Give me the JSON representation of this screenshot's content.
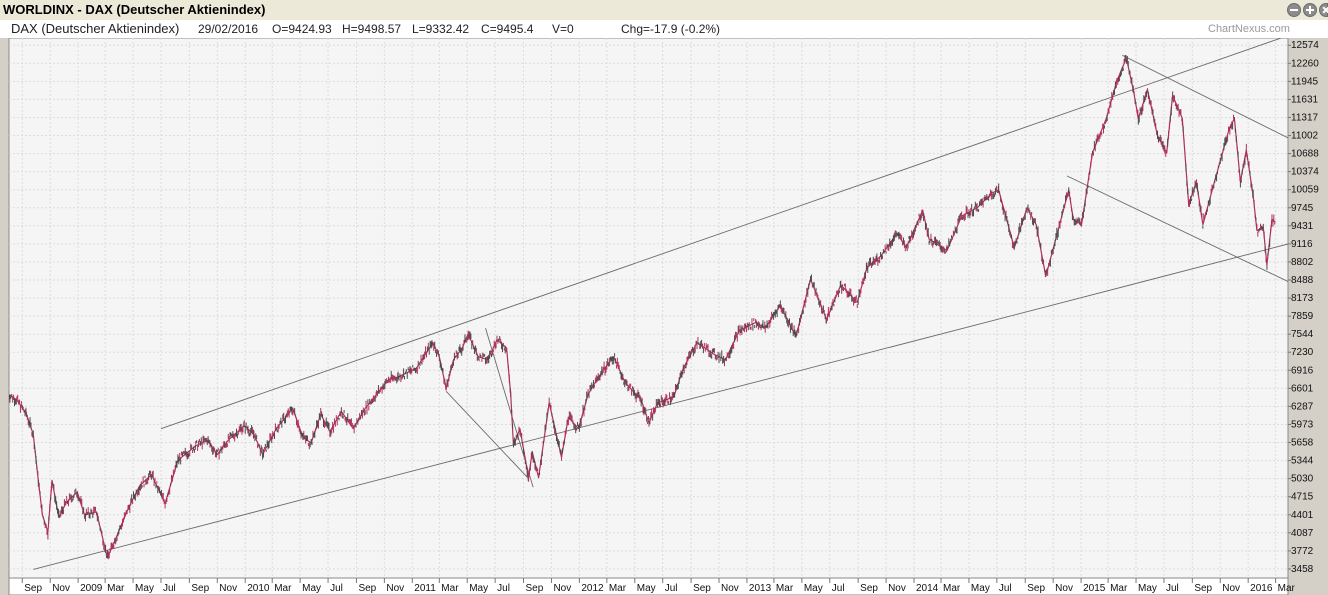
{
  "window": {
    "title": "WORLDINX - DAX (Deutscher Aktienindex)"
  },
  "info": {
    "name": "DAX (Deutscher Aktienindex)",
    "date": "29/02/2016",
    "open": "O=9424.93",
    "high": "H=9498.57",
    "low": "L=9332.42",
    "close": "C=9495.4",
    "volume": "V=0",
    "change": "Chg=-17.9 (-0.2%)",
    "brand": "ChartNexus.com"
  },
  "chart_data": {
    "type": "line",
    "title": "DAX (Deutscher Aktienindex)",
    "xlabel": "",
    "ylabel": "",
    "y_axis_position": "right",
    "grid": true,
    "x_range": [
      "2008-08",
      "2016-03"
    ],
    "ylim": [
      3300,
      12700
    ],
    "y_ticks": [
      3458,
      3772,
      4087,
      4401,
      4715,
      5030,
      5344,
      5658,
      5973,
      6287,
      6601,
      6916,
      7230,
      7544,
      7859,
      8173,
      8488,
      8802,
      9116,
      9431,
      9745,
      10059,
      10374,
      10688,
      11002,
      11317,
      11631,
      11945,
      12260,
      12574
    ],
    "x_ticks": [
      {
        "date": "2008-09",
        "label": "Sep"
      },
      {
        "date": "2008-11",
        "label": "Nov"
      },
      {
        "date": "2009-01",
        "label": "2009"
      },
      {
        "date": "2009-03",
        "label": "Mar"
      },
      {
        "date": "2009-05",
        "label": "May"
      },
      {
        "date": "2009-07",
        "label": "Jul"
      },
      {
        "date": "2009-09",
        "label": "Sep"
      },
      {
        "date": "2009-11",
        "label": "Nov"
      },
      {
        "date": "2010-01",
        "label": "2010"
      },
      {
        "date": "2010-03",
        "label": "Mar"
      },
      {
        "date": "2010-05",
        "label": "May"
      },
      {
        "date": "2010-07",
        "label": "Jul"
      },
      {
        "date": "2010-09",
        "label": "Sep"
      },
      {
        "date": "2010-11",
        "label": "Nov"
      },
      {
        "date": "2011-01",
        "label": "2011"
      },
      {
        "date": "2011-03",
        "label": "Mar"
      },
      {
        "date": "2011-05",
        "label": "May"
      },
      {
        "date": "2011-07",
        "label": "Jul"
      },
      {
        "date": "2011-09",
        "label": "Sep"
      },
      {
        "date": "2011-11",
        "label": "Nov"
      },
      {
        "date": "2012-01",
        "label": "2012"
      },
      {
        "date": "2012-03",
        "label": "Mar"
      },
      {
        "date": "2012-05",
        "label": "May"
      },
      {
        "date": "2012-07",
        "label": "Jul"
      },
      {
        "date": "2012-09",
        "label": "Sep"
      },
      {
        "date": "2012-11",
        "label": "Nov"
      },
      {
        "date": "2013-01",
        "label": "2013"
      },
      {
        "date": "2013-03",
        "label": "Mar"
      },
      {
        "date": "2013-05",
        "label": "May"
      },
      {
        "date": "2013-07",
        "label": "Jul"
      },
      {
        "date": "2013-09",
        "label": "Sep"
      },
      {
        "date": "2013-11",
        "label": "Nov"
      },
      {
        "date": "2014-01",
        "label": "2014"
      },
      {
        "date": "2014-03",
        "label": "Mar"
      },
      {
        "date": "2014-05",
        "label": "May"
      },
      {
        "date": "2014-07",
        "label": "Jul"
      },
      {
        "date": "2014-09",
        "label": "Sep"
      },
      {
        "date": "2014-11",
        "label": "Nov"
      },
      {
        "date": "2015-01",
        "label": "2015"
      },
      {
        "date": "2015-03",
        "label": "Mar"
      },
      {
        "date": "2015-05",
        "label": "May"
      },
      {
        "date": "2015-07",
        "label": "Jul"
      },
      {
        "date": "2015-09",
        "label": "Sep"
      },
      {
        "date": "2015-11",
        "label": "Nov"
      },
      {
        "date": "2016-01",
        "label": "2016"
      },
      {
        "date": "2016-03",
        "label": "Mar"
      }
    ],
    "series": [
      {
        "color": "#b0305a",
        "points": [
          [
            "2008-08-01",
            6500
          ],
          [
            "2008-08-20",
            6400
          ],
          [
            "2008-09-10",
            6150
          ],
          [
            "2008-09-25",
            5800
          ],
          [
            "2008-10-06",
            5000
          ],
          [
            "2008-10-15",
            4400
          ],
          [
            "2008-10-27",
            4100
          ],
          [
            "2008-11-05",
            5000
          ],
          [
            "2008-11-20",
            4350
          ],
          [
            "2008-12-05",
            4600
          ],
          [
            "2008-12-30",
            4800
          ],
          [
            "2009-01-15",
            4400
          ],
          [
            "2009-02-10",
            4450
          ],
          [
            "2009-03-06",
            3650
          ],
          [
            "2009-03-25",
            4000
          ],
          [
            "2009-04-20",
            4500
          ],
          [
            "2009-05-15",
            4900
          ],
          [
            "2009-06-10",
            5100
          ],
          [
            "2009-07-10",
            4600
          ],
          [
            "2009-08-07",
            5350
          ],
          [
            "2009-09-15",
            5600
          ],
          [
            "2009-10-10",
            5700
          ],
          [
            "2009-11-01",
            5450
          ],
          [
            "2009-11-25",
            5700
          ],
          [
            "2009-12-30",
            5950
          ],
          [
            "2010-01-20",
            5800
          ],
          [
            "2010-02-08",
            5450
          ],
          [
            "2010-03-10",
            5900
          ],
          [
            "2010-04-15",
            6250
          ],
          [
            "2010-05-07",
            5750
          ],
          [
            "2010-05-25",
            5650
          ],
          [
            "2010-06-15",
            6150
          ],
          [
            "2010-07-05",
            5850
          ],
          [
            "2010-07-30",
            6200
          ],
          [
            "2010-08-25",
            5900
          ],
          [
            "2010-09-20",
            6250
          ],
          [
            "2010-10-15",
            6500
          ],
          [
            "2010-11-10",
            6750
          ],
          [
            "2010-12-01",
            6800
          ],
          [
            "2011-01-10",
            6950
          ],
          [
            "2011-02-15",
            7400
          ],
          [
            "2011-03-01",
            7150
          ],
          [
            "2011-03-16",
            6600
          ],
          [
            "2011-04-01",
            7100
          ],
          [
            "2011-04-20",
            7300
          ],
          [
            "2011-05-03",
            7550
          ],
          [
            "2011-05-25",
            7150
          ],
          [
            "2011-06-15",
            7100
          ],
          [
            "2011-07-05",
            7450
          ],
          [
            "2011-07-26",
            7300
          ],
          [
            "2011-08-04",
            6500
          ],
          [
            "2011-08-10",
            5600
          ],
          [
            "2011-08-24",
            5900
          ],
          [
            "2011-09-12",
            5050
          ],
          [
            "2011-09-20",
            5500
          ],
          [
            "2011-10-04",
            5050
          ],
          [
            "2011-10-27",
            6350
          ],
          [
            "2011-11-23",
            5400
          ],
          [
            "2011-12-08",
            6100
          ],
          [
            "2011-12-30",
            5900
          ],
          [
            "2012-01-20",
            6500
          ],
          [
            "2012-02-20",
            6900
          ],
          [
            "2012-03-16",
            7150
          ],
          [
            "2012-04-10",
            6700
          ],
          [
            "2012-05-15",
            6400
          ],
          [
            "2012-06-01",
            6000
          ],
          [
            "2012-06-20",
            6350
          ],
          [
            "2012-07-25",
            6450
          ],
          [
            "2012-08-15",
            6950
          ],
          [
            "2012-09-14",
            7400
          ],
          [
            "2012-10-20",
            7200
          ],
          [
            "2012-11-15",
            7100
          ],
          [
            "2012-12-15",
            7600
          ],
          [
            "2013-01-20",
            7750
          ],
          [
            "2013-02-10",
            7650
          ],
          [
            "2013-03-15",
            8050
          ],
          [
            "2013-04-18",
            7500
          ],
          [
            "2013-05-20",
            8500
          ],
          [
            "2013-06-24",
            7800
          ],
          [
            "2013-07-25",
            8400
          ],
          [
            "2013-08-30",
            8100
          ],
          [
            "2013-09-20",
            8700
          ],
          [
            "2013-10-20",
            8900
          ],
          [
            "2013-11-25",
            9300
          ],
          [
            "2013-12-15",
            9050
          ],
          [
            "2014-01-20",
            9700
          ],
          [
            "2014-02-03",
            9200
          ],
          [
            "2014-03-14",
            9000
          ],
          [
            "2014-04-15",
            9600
          ],
          [
            "2014-05-20",
            9750
          ],
          [
            "2014-06-20",
            10000
          ],
          [
            "2014-07-05",
            10050
          ],
          [
            "2014-08-08",
            9050
          ],
          [
            "2014-09-05",
            9750
          ],
          [
            "2014-09-25",
            9450
          ],
          [
            "2014-10-16",
            8550
          ],
          [
            "2014-11-10",
            9300
          ],
          [
            "2014-12-05",
            10050
          ],
          [
            "2014-12-15",
            9550
          ],
          [
            "2015-01-02",
            9450
          ],
          [
            "2015-01-26",
            10700
          ],
          [
            "2015-02-25",
            11300
          ],
          [
            "2015-03-20",
            11950
          ],
          [
            "2015-04-10",
            12350
          ],
          [
            "2015-04-25",
            11800
          ],
          [
            "2015-05-06",
            11300
          ],
          [
            "2015-05-26",
            11800
          ],
          [
            "2015-06-17",
            11000
          ],
          [
            "2015-07-07",
            10700
          ],
          [
            "2015-07-20",
            11700
          ],
          [
            "2015-08-10",
            11300
          ],
          [
            "2015-08-24",
            9800
          ],
          [
            "2015-09-10",
            10200
          ],
          [
            "2015-09-24",
            9450
          ],
          [
            "2015-10-16",
            10100
          ],
          [
            "2015-11-20",
            11100
          ],
          [
            "2015-12-02",
            11300
          ],
          [
            "2015-12-15",
            10200
          ],
          [
            "2015-12-28",
            10750
          ],
          [
            "2016-01-12",
            9950
          ],
          [
            "2016-01-20",
            9350
          ],
          [
            "2016-02-03",
            9400
          ],
          [
            "2016-02-11",
            8750
          ],
          [
            "2016-02-22",
            9550
          ],
          [
            "2016-02-29",
            9495.4
          ]
        ]
      }
    ],
    "trendlines": [
      {
        "from": [
          "2008-09-25",
          3450
        ],
        "to": [
          "2016-03-31",
          9120
        ]
      },
      {
        "from": [
          "2009-07-01",
          5900
        ],
        "to": [
          "2016-03-31",
          12750
        ]
      },
      {
        "from": [
          "2011-06-10",
          7650
        ],
        "to": [
          "2011-09-22",
          4880
        ]
      },
      {
        "from": [
          "2011-03-16",
          6550
        ],
        "to": [
          "2011-09-12",
          5030
        ]
      },
      {
        "from": [
          "2015-04-01",
          12400
        ],
        "to": [
          "2016-03-31",
          10950
        ]
      },
      {
        "from": [
          "2014-12-01",
          10300
        ],
        "to": [
          "2016-03-31",
          8450
        ]
      }
    ]
  }
}
